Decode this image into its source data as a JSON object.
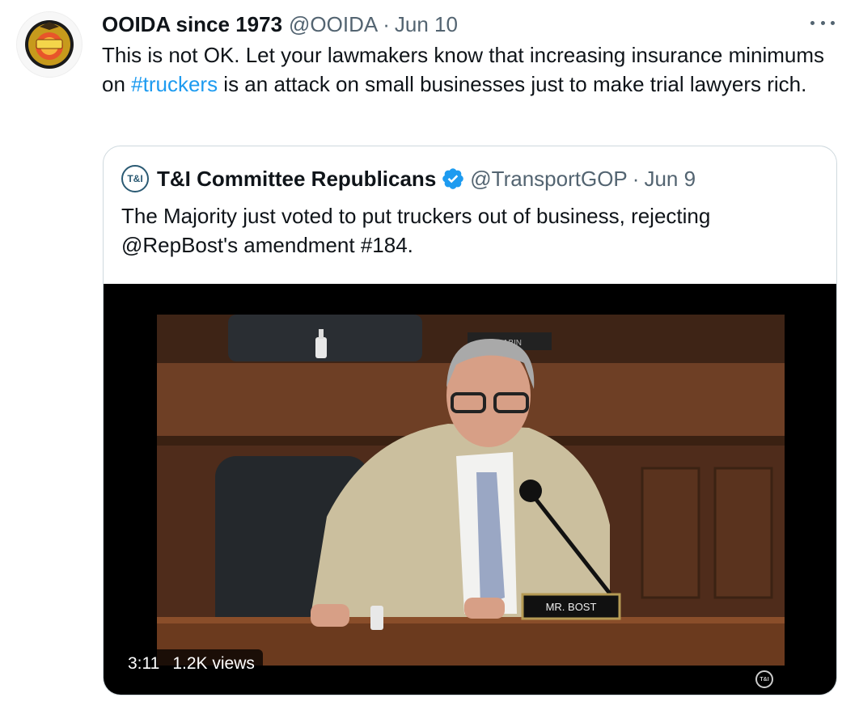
{
  "tweet": {
    "display_name": "OOIDA since 1973",
    "handle": "@OOIDA",
    "separator": "·",
    "date": "Jun 10",
    "text_before": "This is not OK. Let your lawmakers know that increasing insurance minimums on ",
    "hashtag": "#truckers",
    "text_after": " is an attack on small businesses just to make trial lawyers rich.",
    "avatar_logo_text": "OOIDA",
    "more_icon": "ellipsis-icon"
  },
  "quoted": {
    "avatar_text": "T&I",
    "display_name": "T&I Committee Republicans",
    "verified_icon": "verified-badge-icon",
    "handle": "@TransportGOP",
    "separator": "·",
    "date": "Jun 9",
    "text": "The Majority just voted to put truckers out of business, rejecting @RepBost's amendment #184.",
    "video": {
      "duration": "3:11",
      "views": "1.2K views",
      "nameplate": "MR. BOST",
      "nameplate_back": "BABIN",
      "watermark": "T&I"
    }
  },
  "colors": {
    "link": "#1d9bf0",
    "secondary_text": "#536471",
    "border": "#cfd9de",
    "verified": "#1d9bf0"
  }
}
